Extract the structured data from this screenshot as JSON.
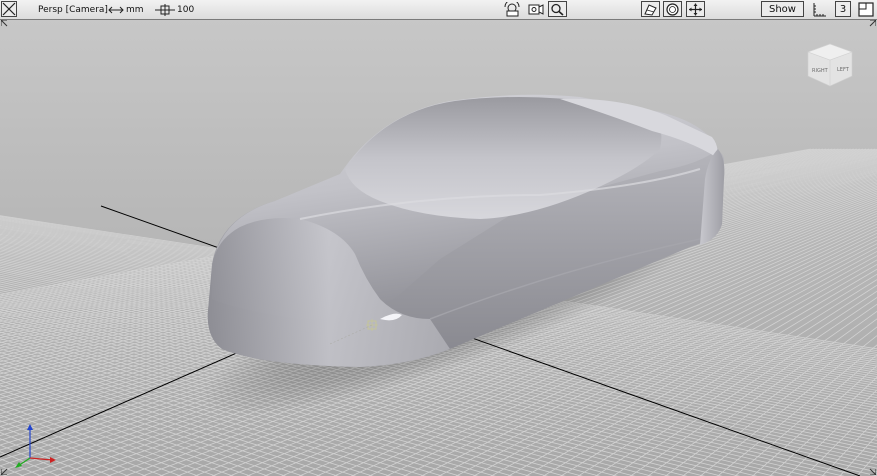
{
  "viewport": {
    "camera_label": "Persp [Camera]",
    "units_label": "mm",
    "scale_value": "100",
    "show_button": "Show",
    "layout_number": "3"
  },
  "icons": {
    "close": "close-icon",
    "units": "double-arrow-icon",
    "scale": "scale-crosshair-icon",
    "camera_tumble": "camera-tumble-icon",
    "camera_track": "camera-track-icon",
    "zoom": "zoom-icon",
    "render_mode": "render-mode-icon",
    "sphere": "sphere-icon",
    "move": "move-icon",
    "grid_snap": "grid-snap-icon",
    "maximize": "maximize-icon"
  },
  "viewcube": {
    "right_face": "RIGHT",
    "left_face": "LEFT"
  },
  "colors": {
    "toolbar_bg": "#e6e6e6",
    "background": "#b0b0b0",
    "grid_line": "#d0d0d0",
    "axis_line": "#000000",
    "model": "#c6c6cc",
    "axis_x": "#cc2222",
    "axis_y": "#22aa22",
    "axis_z": "#2244cc"
  }
}
